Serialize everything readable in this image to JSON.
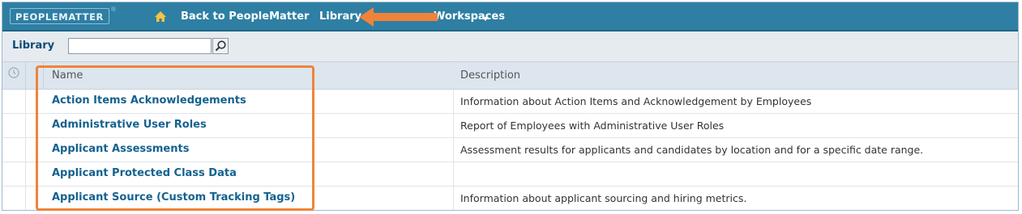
{
  "brand": {
    "logo_text": "PEOPLEMATTER",
    "logo_mark": "®",
    "accent": "#2e7fa3",
    "highlight": "#f0833a"
  },
  "nav": {
    "home_icon": "home-icon",
    "back_label": "Back to PeopleMatter",
    "library_label": "Library",
    "workspaces_label": "Workspaces"
  },
  "toolbar": {
    "label": "Library",
    "search_value": "",
    "search_icon": "search-icon"
  },
  "table": {
    "columns": [
      "Name",
      "Description"
    ],
    "rows": [
      {
        "name": "Action Items Acknowledgements",
        "description": "Information about Action Items and Acknowledgement by Employees"
      },
      {
        "name": "Administrative User Roles",
        "description": "Report of Employees with Administrative User Roles"
      },
      {
        "name": "Applicant Assessments",
        "description": "Assessment results for applicants and candidates by location and for a specific date range."
      },
      {
        "name": "Applicant Protected Class Data",
        "description": ""
      },
      {
        "name": "Applicant Source (Custom Tracking Tags)",
        "description": "Information about applicant sourcing and hiring metrics."
      }
    ]
  }
}
